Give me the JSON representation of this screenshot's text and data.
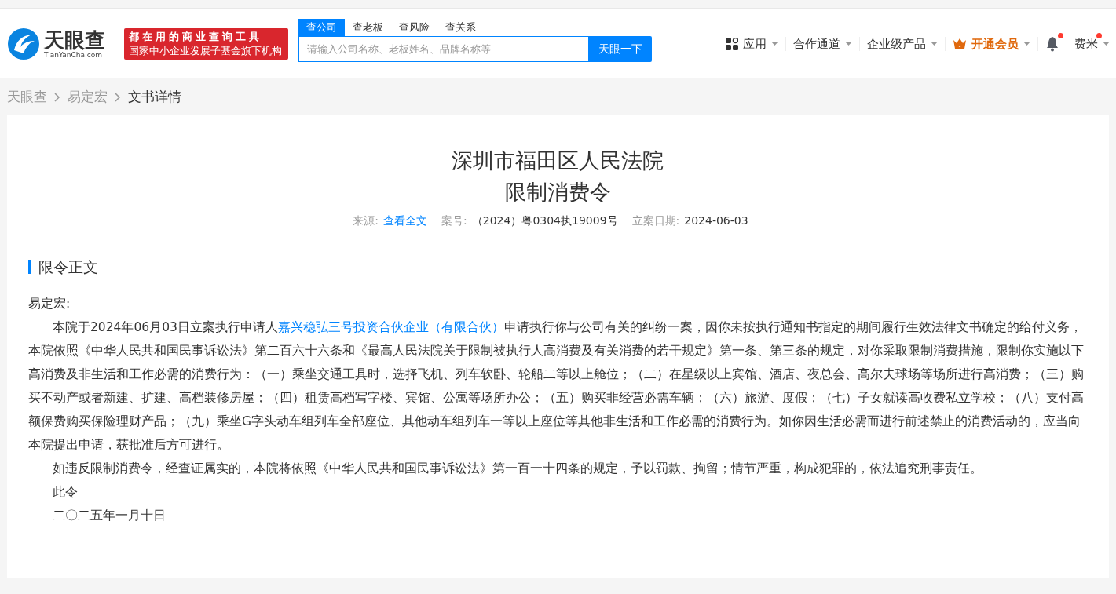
{
  "header": {
    "logo": {
      "name": "天眼查",
      "domain": "TianYanCha.com"
    },
    "slogan": [
      "都在用的商业查询工具",
      "国家中小企业发展子基金旗下机构"
    ],
    "search": {
      "tabs": [
        {
          "label": "查公司",
          "selected": true
        },
        {
          "label": "查老板",
          "selected": false
        },
        {
          "label": "查风险",
          "selected": false
        },
        {
          "label": "查关系",
          "selected": false
        }
      ],
      "placeholder": "请输入公司名称、老板姓名、品牌名称等",
      "button": "天眼一下"
    },
    "nav": [
      {
        "kind": "apps",
        "label": "应用",
        "has_dot": false
      },
      {
        "kind": "menu",
        "label": "合作通道",
        "has_dot": false
      },
      {
        "kind": "menu",
        "label": "企业级产品",
        "has_dot": false
      },
      {
        "kind": "vip",
        "label": "开通会员",
        "has_dot": false
      },
      {
        "kind": "bell",
        "has_dot": true
      },
      {
        "kind": "user",
        "label": "费米",
        "has_dot": true
      }
    ]
  },
  "breadcrumb": [
    {
      "label": "天眼查",
      "selected": false
    },
    {
      "label": "易定宏",
      "selected": false
    },
    {
      "label": "文书详情",
      "selected": true
    }
  ],
  "document": {
    "court": "深圳市福田区人民法院",
    "title": "限制消费令",
    "meta": [
      {
        "label": "来源:",
        "value": "查看全文",
        "kind": "link"
      },
      {
        "label": "案号:",
        "value": "（2024）粤0304执19009号",
        "kind": "text"
      },
      {
        "label": "立案日期:",
        "value": "2024-06-03",
        "kind": "text"
      }
    ],
    "section_title": "限令正文",
    "salutation": "易定宏:",
    "paragraphs": [
      {
        "parts": [
          {
            "text": "本院于2024年06月03日立案执行申请人",
            "kind": "text"
          },
          {
            "text": "嘉兴稳弘三号投资合伙企业（有限合伙）",
            "kind": "link"
          },
          {
            "text": "申请执行你与公司有关的纠纷一案，因你未按执行通知书指定的期间履行生效法律文书确定的给付义务，本院依照《中华人民共和国民事诉讼法》第二百六十六条和《最高人民法院关于限制被执行人高消费及有关消费的若干规定》第一条、第三条的规定，对你采取限制消费措施，限制你实施以下高消费及非生活和工作必需的消费行为：（一）乘坐交通工具时，选择飞机、列车软卧、轮船二等以上舱位；（二）在星级以上宾馆、酒店、夜总会、高尔夫球场等场所进行高消费；（三）购买不动产或者新建、扩建、高档装修房屋；（四）租赁高档写字楼、宾馆、公寓等场所办公；（五）购买非经营必需车辆；（六）旅游、度假；（七）子女就读高收费私立学校；（八）支付高额保费购买保险理财产品；（九）乘坐G字头动车组列车全部座位、其他动车组列车一等以上座位等其他非生活和工作必需的消费行为。如你因生活必需而进行前述禁止的消费活动的，应当向本院提出申请，获批准后方可进行。",
            "kind": "text"
          }
        ]
      },
      {
        "parts": [
          {
            "text": "如违反限制消费令，经查证属实的，本院将依照《中华人民共和国民事诉讼法》第一百一十四条的规定，予以罚款、拘留；情节严重，构成犯罪的，依法追究刑事责任。",
            "kind": "text"
          }
        ]
      },
      {
        "parts": [
          {
            "text": "此令",
            "kind": "text"
          }
        ]
      },
      {
        "parts": [
          {
            "text": "二〇二五年一月十日",
            "kind": "text"
          }
        ]
      }
    ]
  }
}
